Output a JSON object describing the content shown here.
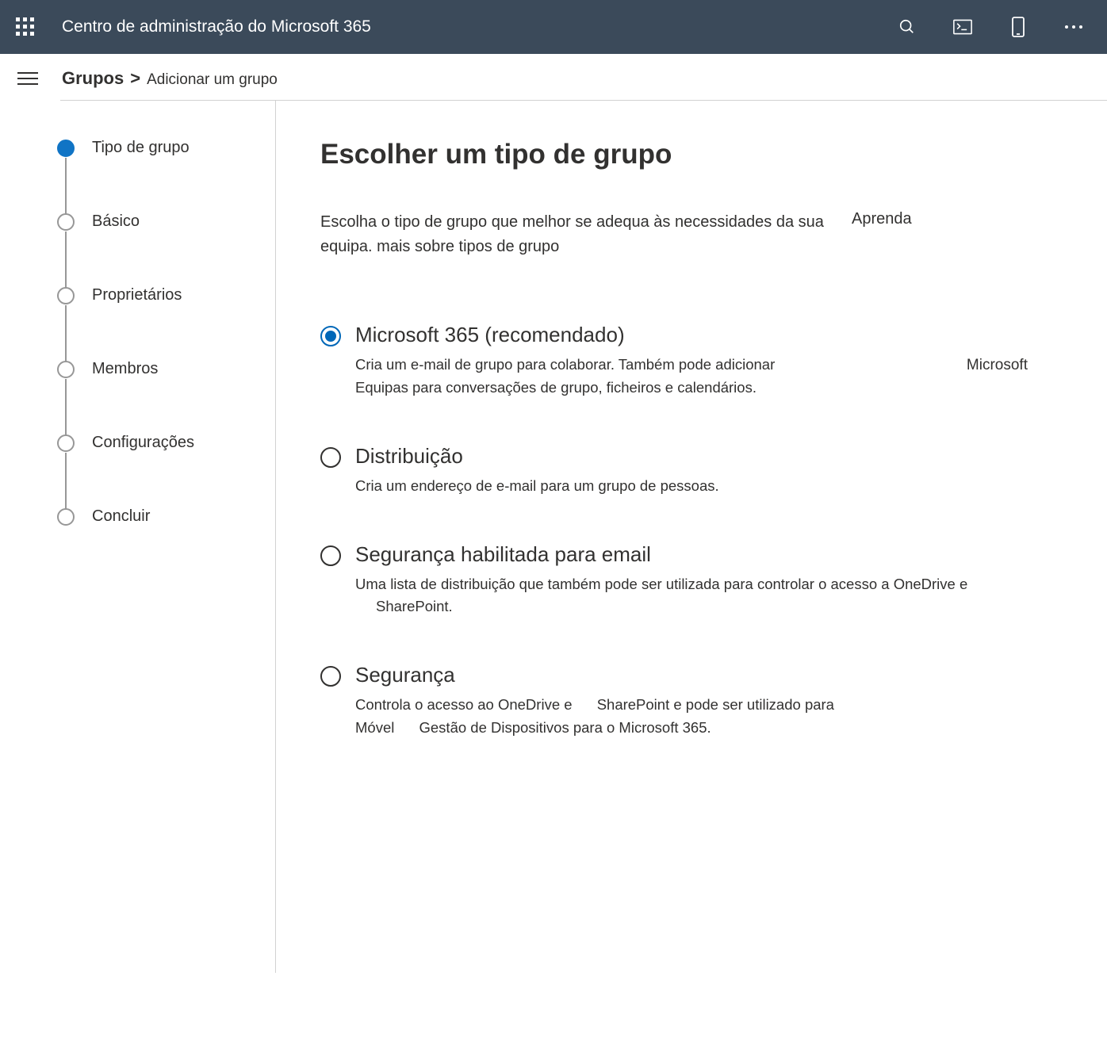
{
  "topbar": {
    "title": "Centro de administração do Microsoft 365"
  },
  "breadcrumb": {
    "first": "Grupos",
    "sep": "&gt;",
    "second": "Adicionar um grupo"
  },
  "steps": [
    {
      "label": "Tipo de grupo",
      "active": true
    },
    {
      "label": "Básico",
      "active": false
    },
    {
      "label": "Proprietários",
      "active": false
    },
    {
      "label": "Membros",
      "active": false
    },
    {
      "label": "Configurações",
      "active": false
    },
    {
      "label": "Concluir",
      "active": false
    }
  ],
  "content": {
    "title": "Escolher um tipo de grupo",
    "intro_text": "Escolha o tipo de grupo que melhor se adequa às necessidades da sua equipa. mais sobre tipos de grupo",
    "intro_link": "Aprenda",
    "options": [
      {
        "title": "Microsoft 365 (recomendado)",
        "desc_line1": "Cria um e-mail de grupo para colaborar. Também pode adicionar",
        "desc_right": "Microsoft",
        "desc_line2": "Equipas para conversações de grupo, ficheiros e calendários.",
        "selected": true
      },
      {
        "title": "Distribuição",
        "desc": "Cria um endereço de e-mail para um grupo de pessoas.",
        "selected": false
      },
      {
        "title": "Segurança habilitada para email",
        "desc_a": "Uma lista de distribuição que também pode ser utilizada para controlar o acesso a OneDrive e",
        "desc_b": "SharePoint.",
        "selected": false
      },
      {
        "title": "Segurança",
        "desc_a": "Controla o acesso ao OneDrive e",
        "desc_b": "SharePoint e pode ser utilizado para",
        "desc_c": "Móvel",
        "desc_d": "Gestão de Dispositivos para o Microsoft 365.",
        "selected": false
      }
    ]
  }
}
